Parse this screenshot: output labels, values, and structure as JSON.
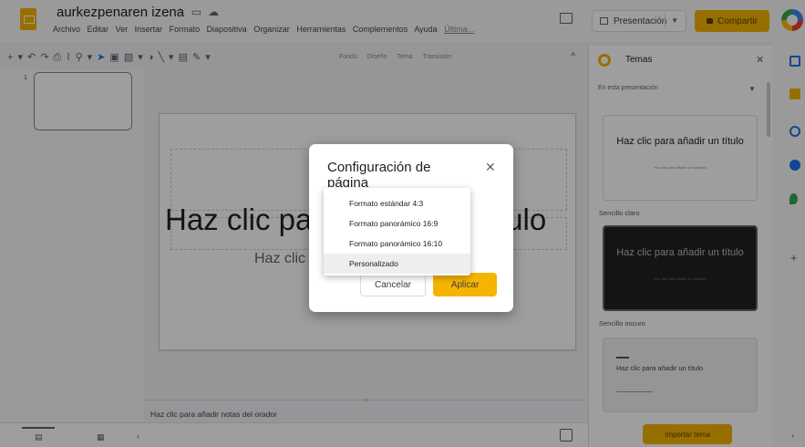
{
  "app": {
    "doc_title": "aurkezpenaren izena",
    "title_icons": [
      "star-icon",
      "folder-icon",
      "cloud-icon"
    ],
    "menu": [
      "Archivo",
      "Editar",
      "Ver",
      "Insertar",
      "Formato",
      "Diapositiva",
      "Organizar",
      "Herramientas",
      "Complementos",
      "Ayuda"
    ],
    "menu_last": "Última...",
    "present_label": "Presentación",
    "share_label": "Compartir",
    "accent_color": "#f4b400"
  },
  "toolbar": {
    "labels": [
      "Fondo",
      "Diseño",
      "Tema",
      "Transición"
    ]
  },
  "filmstrip": {
    "slide_number": "1"
  },
  "slide": {
    "title": "Haz clic para añadir un título",
    "subtitle": "Haz clic para añadir un subtítulo"
  },
  "notes": {
    "placeholder": "Haz clic para añadir notas del orador"
  },
  "themes_panel": {
    "title": "Temas",
    "dropdown": "En esta presentación",
    "themes": [
      {
        "preview_title": "Haz clic para añadir un título",
        "preview_sub": "Haz clic para añadir un subtítulo",
        "label": "Sencillo claro"
      },
      {
        "preview_title": "Haz clic para añadir un título",
        "preview_sub": "Haz clic para añadir un subtítulo",
        "label": "Sencillo oscuro"
      },
      {
        "preview_title": "Haz clic para añadir un título"
      }
    ],
    "import_label": "Importar tema"
  },
  "dialog": {
    "title": "Configuración de página",
    "close_icon": "close-icon",
    "cancel_label": "Cancelar",
    "apply_label": "Aplicar",
    "options": [
      "Formato estándar 4:3",
      "Formato panorámico 16:9",
      "Formato panorámico 16:10",
      "Personalizado"
    ],
    "selected_option": "Personalizado"
  }
}
